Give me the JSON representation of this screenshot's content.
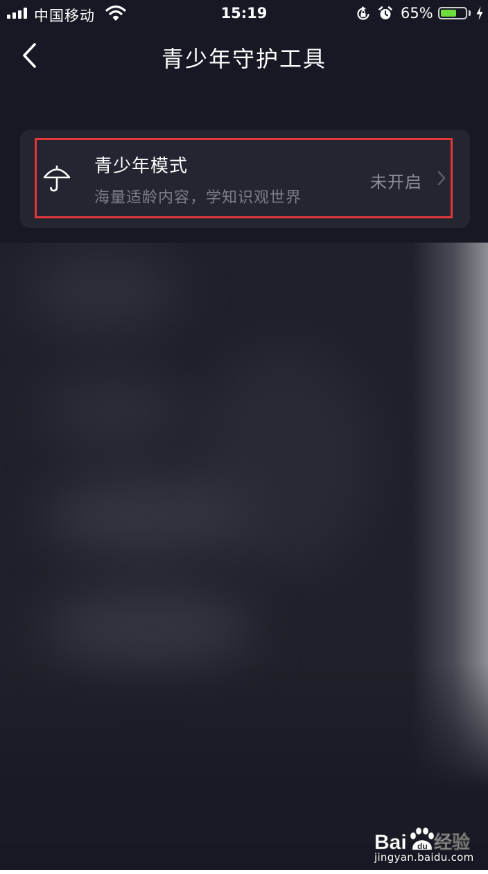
{
  "status_bar": {
    "carrier": "中国移动",
    "time": "15:19",
    "battery_percent": "65%",
    "battery_level": 0.65,
    "icons": [
      "signal-icon",
      "wifi-icon",
      "rotation-lock-icon",
      "alarm-icon",
      "battery-icon",
      "charging-icon"
    ]
  },
  "nav": {
    "title": "青少年守护工具",
    "back_icon": "chevron-left-icon"
  },
  "teen_mode": {
    "title": "青少年模式",
    "subtitle": "海量适龄内容，学知识观世界",
    "status": "未开启",
    "icon": "umbrella-icon",
    "highlight_color": "#e4373a"
  },
  "watermark": {
    "logo": "Bai度经验",
    "url": "jingyan.baidu.com"
  },
  "colors": {
    "background": "#171823",
    "card": "#232530",
    "text_primary": "#ffffff",
    "text_secondary": "#7b7d88",
    "battery": "#6fdc3e"
  }
}
